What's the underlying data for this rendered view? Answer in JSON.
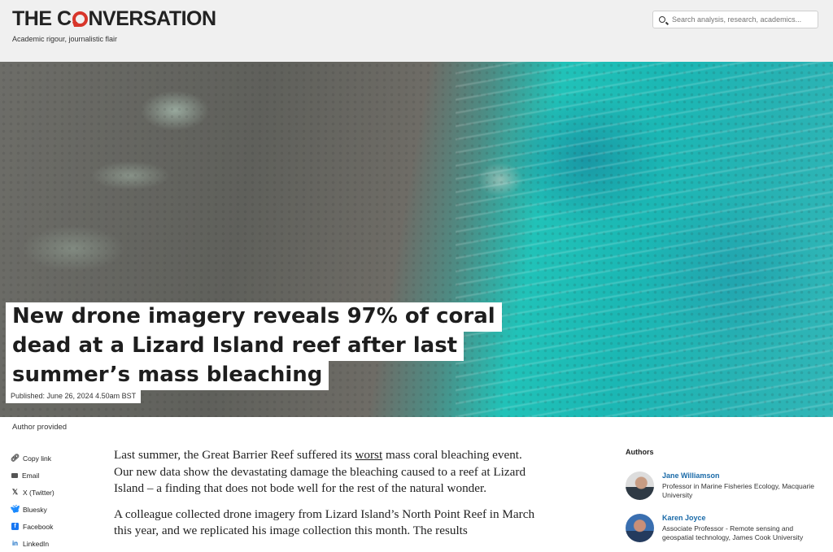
{
  "header": {
    "logo_before": "THE C",
    "logo_after": "NVERSATION",
    "tagline": "Academic rigour, journalistic flair",
    "search_placeholder": "Search analysis, research, academics..."
  },
  "article": {
    "title_lines": [
      "New drone imagery reveals 97% of coral",
      "dead at a Lizard Island reef after last",
      "summer’s mass bleaching"
    ],
    "published": "Published: June 26, 2024 4.50am BST",
    "image_credit": "Author provided",
    "p1_before": "Last summer, the Great Barrier Reef suffered its ",
    "p1_link": "worst",
    "p1_after": " mass coral bleaching event. Our new data show the devastating damage the bleaching caused to a reef at Lizard Island – a finding that does not bode well for the rest of the natural wonder.",
    "p2": "A colleague collected drone imagery from Lizard Island’s North Point Reef in March this year, and we replicated his image collection this month. The results"
  },
  "share": {
    "items": [
      {
        "label": "Copy link",
        "icon": "link-icon"
      },
      {
        "label": "Email",
        "icon": "email-icon"
      },
      {
        "label": "X (Twitter)",
        "icon": "x-icon"
      },
      {
        "label": "Bluesky",
        "icon": "bluesky-icon"
      },
      {
        "label": "Facebook",
        "icon": "facebook-icon"
      },
      {
        "label": "LinkedIn",
        "icon": "linkedin-icon"
      }
    ]
  },
  "authors": {
    "heading": "Authors",
    "list": [
      {
        "name": "Jane Williamson",
        "role": "Professor in Marine Fisheries Ecology, Macquarie University"
      },
      {
        "name": "Karen Joyce",
        "role": "Associate Professor - Remote sensing and geospatial technology, James Cook University"
      }
    ]
  },
  "colors": {
    "accent_red": "#d8352a",
    "author_link_blue": "#1a6aa8"
  }
}
